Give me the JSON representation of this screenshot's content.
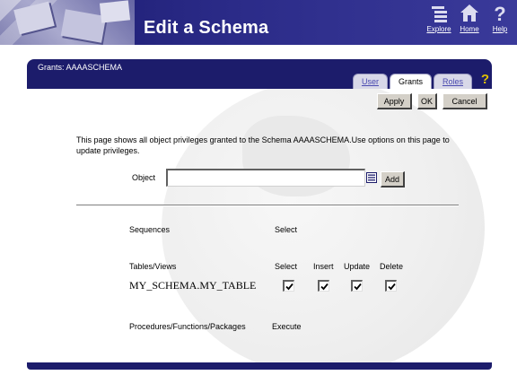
{
  "header": {
    "title": "Edit a Schema",
    "nav": [
      {
        "label": "Explore",
        "icon": "explore-icon"
      },
      {
        "label": "Home",
        "icon": "home-icon"
      },
      {
        "label": "Help",
        "icon": "help-icon"
      }
    ]
  },
  "panel": {
    "breadcrumb": "Grants: AAAASCHEMA",
    "tabs": [
      {
        "label": "User",
        "active": false
      },
      {
        "label": "Grants",
        "active": true
      },
      {
        "label": "Roles",
        "active": false
      }
    ]
  },
  "actions": {
    "apply": "Apply",
    "ok": "OK",
    "cancel": "Cancel"
  },
  "description": "This page shows all object privileges granted to the Schema AAAASCHEMA.Use options on this page to update privileges.",
  "object_field": {
    "label": "Object",
    "value": "",
    "add_label": "Add"
  },
  "sections": {
    "sequences": {
      "label": "Sequences",
      "privileges": [
        "Select"
      ]
    },
    "tables_views": {
      "label": "Tables/Views",
      "privileges": [
        "Select",
        "Insert",
        "Update",
        "Delete"
      ],
      "rows": [
        {
          "name": "MY_SCHEMA.MY_TABLE",
          "select": true,
          "insert": true,
          "update": true,
          "delete": true
        }
      ]
    },
    "procedures": {
      "label": "Procedures/Functions/Packages",
      "privileges": [
        "Execute"
      ]
    }
  },
  "colors": {
    "banner": "#2b2b88",
    "panel_bar": "#1c1c6b",
    "help_accent": "#e0c000"
  }
}
